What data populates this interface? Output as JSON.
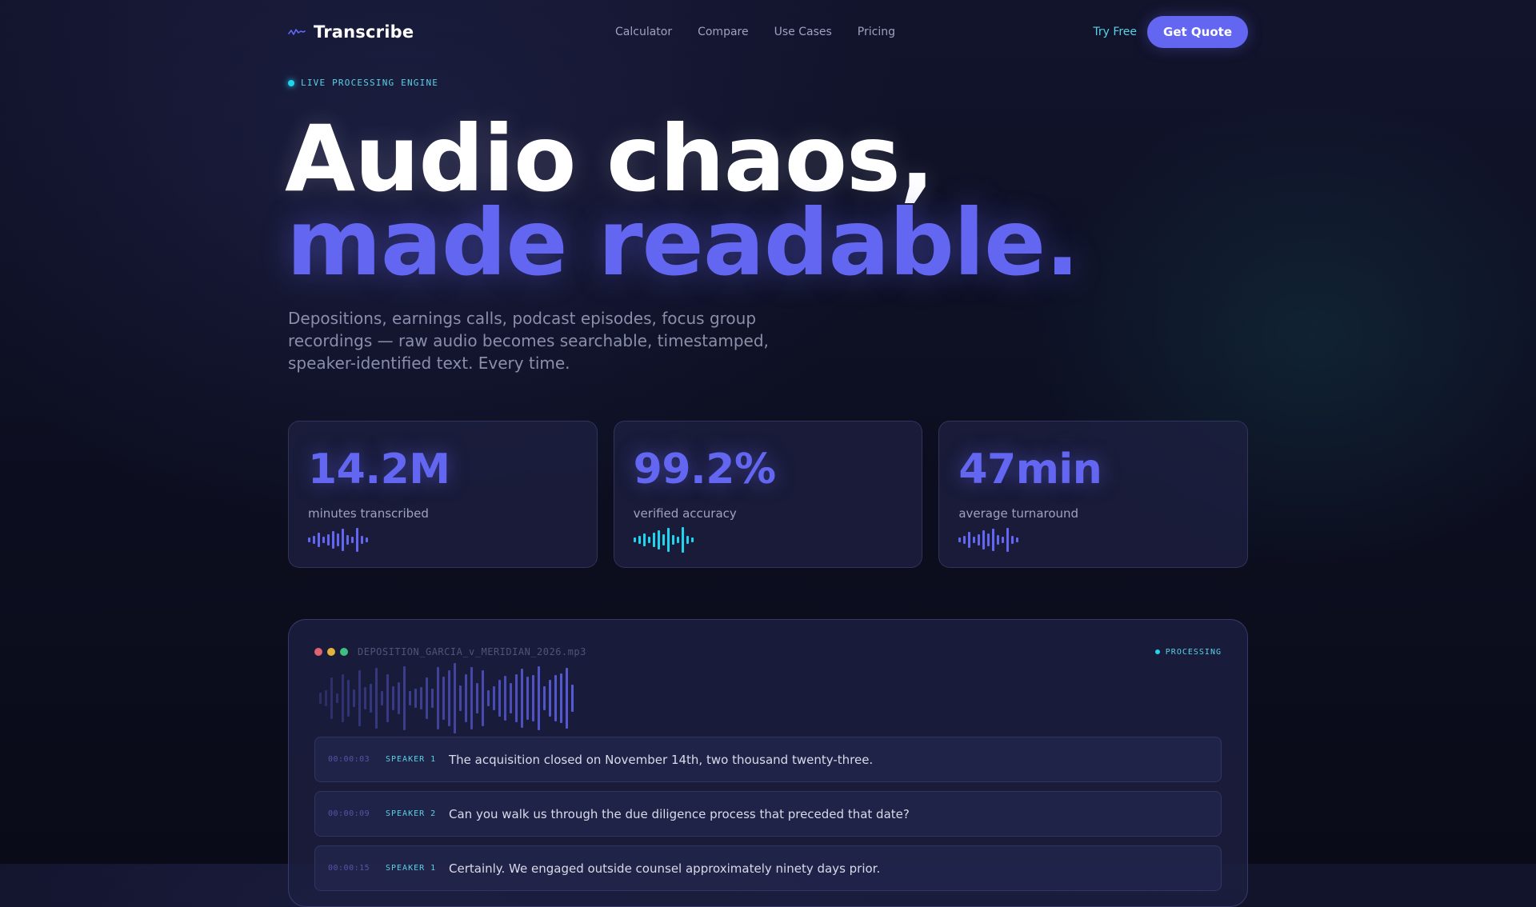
{
  "nav": {
    "brand": "Transcribe",
    "links": [
      "Calculator",
      "Compare",
      "Use Cases",
      "Pricing"
    ],
    "try_free": "Try Free",
    "get_quote": "Get Quote"
  },
  "badge": "LIVE PROCESSING ENGINE",
  "hero": {
    "line1": "Audio chaos,",
    "line2": "made readable.",
    "lead": "Depositions, earnings calls, podcast episodes, focus group recordings — raw audio becomes searchable, timestamped, speaker-identified text. Every time."
  },
  "stats": [
    {
      "value": "14.2M",
      "label": "minutes transcribed",
      "wave_color": "#6366f1"
    },
    {
      "value": "99.2%",
      "label": "verified accuracy",
      "wave_color": "#22d3ee"
    },
    {
      "value": "47min",
      "label": "average turnaround",
      "wave_color": "#6366f1"
    }
  ],
  "panel": {
    "filename": "DEPOSITION_GARCIA_v_MERIDIAN_2026.mp3",
    "status": "PROCESSING",
    "window_dots": [
      "#e0636f",
      "#e2b23c",
      "#3fbf7f"
    ],
    "rows": [
      {
        "time": "00:00:03",
        "speaker": "SPEAKER 1",
        "text": "The acquisition closed on November 14th, two thousand twenty-three."
      },
      {
        "time": "00:00:09",
        "speaker": "SPEAKER 2",
        "text": "Can you walk us through the due diligence process that preceded that date?"
      },
      {
        "time": "00:00:15",
        "speaker": "SPEAKER 1",
        "text": "Certainly. We engaged outside counsel approximately ninety days prior."
      }
    ]
  },
  "colors": {
    "accent": "#6366f1",
    "cyan": "#22d3ee",
    "background": "#0d0f22"
  }
}
